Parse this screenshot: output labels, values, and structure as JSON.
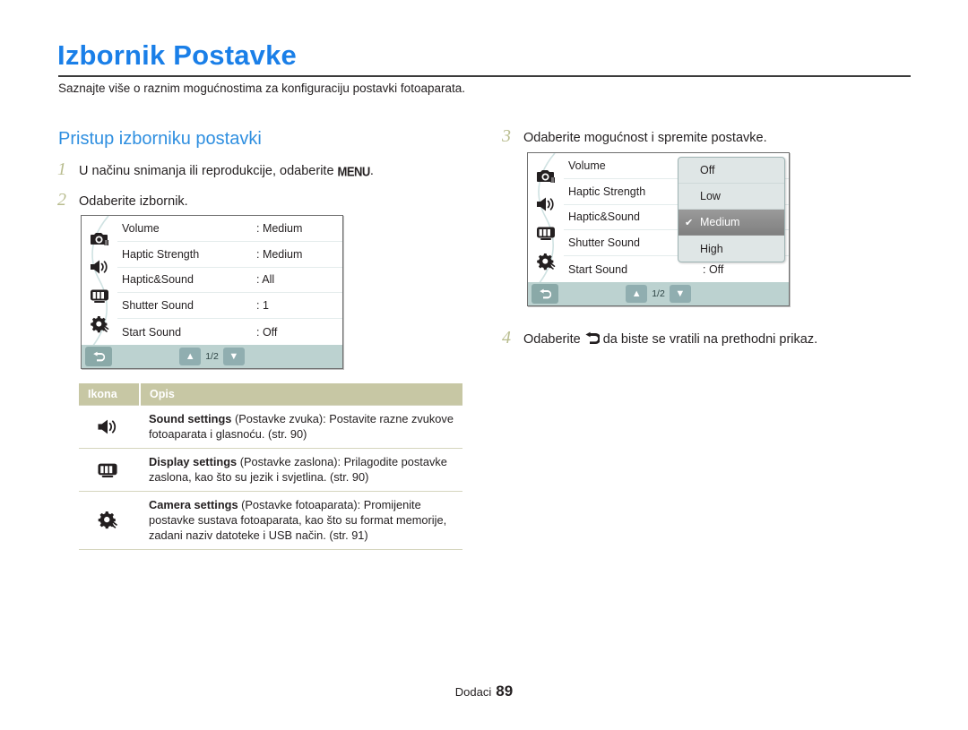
{
  "header": {
    "title": "Izbornik Postavke",
    "subtitle": "Saznajte više o raznim mogućnostima za konfiguraciju postavki fotoaparata."
  },
  "section": {
    "heading": "Pristup izborniku postavki"
  },
  "steps": [
    {
      "num": "1",
      "pre": "U načinu snimanja ili reprodukcije, odaberite ",
      "glyph": "MENU",
      "post": "."
    },
    {
      "num": "2",
      "pre": "Odaberite izbornik.",
      "glyph": "",
      "post": ""
    },
    {
      "num": "3",
      "pre": "Odaberite mogućnost i spremite postavke.",
      "glyph": "",
      "post": ""
    },
    {
      "num": "4",
      "pre": "Odaberite ",
      "glyph": "↰",
      "post": " da biste se vratili na prethodni prikaz."
    }
  ],
  "screen1": {
    "icons": [
      "camera-icon",
      "sound-icon",
      "display-icon",
      "gear-icon"
    ],
    "rows": [
      {
        "label": "Volume",
        "value": ": Medium"
      },
      {
        "label": "Haptic Strength",
        "value": ": Medium"
      },
      {
        "label": "Haptic&Sound",
        "value": ": All"
      },
      {
        "label": "Shutter Sound",
        "value": ": 1"
      },
      {
        "label": "Start Sound",
        "value": ": Off"
      }
    ],
    "back_label": "↰",
    "pager": {
      "up": "▲",
      "page": "1/2",
      "down": "▼"
    }
  },
  "screen2": {
    "icons": [
      "camera-icon",
      "sound-icon",
      "display-icon",
      "gear-icon"
    ],
    "rows": [
      {
        "label": "Volume",
        "value": ""
      },
      {
        "label": "Haptic Strength",
        "value": ""
      },
      {
        "label": "Haptic&Sound",
        "value": ""
      },
      {
        "label": "Shutter Sound",
        "value": ""
      },
      {
        "label": "Start Sound",
        "value": ": Off"
      }
    ],
    "dropdown": {
      "options": [
        {
          "label": "Off",
          "selected": false
        },
        {
          "label": "Low",
          "selected": false
        },
        {
          "label": "Medium",
          "selected": true
        },
        {
          "label": "High",
          "selected": false
        }
      ],
      "check": "✔"
    },
    "back_label": "↰",
    "pager": {
      "up": "▲",
      "page": "1/2",
      "down": "▼"
    }
  },
  "table": {
    "headers": {
      "icon": "Ikona",
      "description": "Opis"
    },
    "rows": [
      {
        "icon": "sound-icon",
        "bold": "Sound settings",
        "text": " (Postavke zvuka): Postavite razne zvukove fotoaparata i glasnoću. (str. 90)"
      },
      {
        "icon": "display-icon",
        "bold": "Display settings",
        "text": " (Postavke zaslona): Prilagodite postavke zaslona, kao što su jezik i svjetlina. (str. 90)"
      },
      {
        "icon": "gear-icon",
        "bold": "Camera settings",
        "text": " (Postavke fotoaparata): Promijenite postavke sustava fotoaparata, kao što su format memorije, zadani naziv datoteke i USB način. (str. 91)"
      }
    ]
  },
  "footer": {
    "label": "Dodaci",
    "page": "89"
  },
  "colors": {
    "title_blue": "#1a7fe8",
    "heading_blue": "#2f8fe0",
    "step_num": "#b9bd8f",
    "table_header": "#c7c7a4",
    "lcd_bottom": "#bcd2d0",
    "dropdown_bg": "#dfe6e6",
    "dropdown_sel": "#8f8f8f"
  }
}
